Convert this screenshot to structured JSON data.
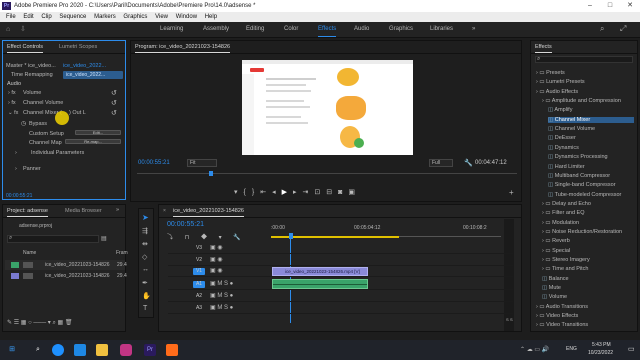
{
  "window": {
    "title": "Adobe Premiere Pro 2020 - C:\\Users\\Paril\\Documents\\Adobe\\Premiere Pro\\14.0\\adsense *",
    "logo": "Pr"
  },
  "menu": [
    "File",
    "Edit",
    "Clip",
    "Sequence",
    "Markers",
    "Graphics",
    "View",
    "Window",
    "Help"
  ],
  "workspaces": {
    "tabs": [
      "Learning",
      "Assembly",
      "Editing",
      "Color",
      "Effects",
      "Audio",
      "Graphics",
      "Libraries"
    ],
    "active": "Effects",
    "more": "»"
  },
  "effect_controls": {
    "tabs": [
      "Effect Controls",
      "Lumetri Scopes"
    ],
    "master": "Master * ice_video...",
    "clip": "ice_video_2022...",
    "time_remapping": "Time Remapping",
    "audio_header": "Audio",
    "effects": [
      "Volume",
      "Channel Volume"
    ],
    "channel_mixer": "Channel Mixer (",
    "channel_mixer_suffix": ") Out L",
    "bypass": "Bypass",
    "custom_setup": "Custom Setup",
    "edit_label": "Edit...",
    "channel_map": "Channel Map",
    "remap_label": "Re-map...",
    "individual_params": "Individual Parameters",
    "panner": "Panner",
    "timecode": "00:00:55:21"
  },
  "program_monitor": {
    "title": "Program: ice_video_20221023-154826",
    "timecode": "00:00:55:21",
    "fit": "Fit",
    "quality": "Full",
    "duration": "00:04:47:12"
  },
  "project": {
    "tabs": [
      "Project: adsense",
      "Media Browser"
    ],
    "file": "adsense.prproj",
    "col_name": "Name",
    "col_fr": "Fram",
    "items": [
      {
        "name": "ice_video_20221023-154826",
        "fr": "29.4"
      },
      {
        "name": "ice_video_20221023-154826",
        "fr": "29.4"
      }
    ]
  },
  "timeline": {
    "tab": "ice_video_20221023-154826",
    "timecode": "00:00:55:21",
    "ruler": [
      ":00:00",
      "00:05:04:12",
      "00:10:08:2"
    ],
    "tracks": [
      "V3",
      "V2",
      "V1",
      "A1",
      "A2",
      "A3"
    ],
    "video_clip": "ice_video_20221023-154826.mp4 [V]",
    "meter_labels": [
      "S",
      "S"
    ]
  },
  "effects_panel": {
    "title": "Effects",
    "tree": [
      {
        "label": "Presets",
        "indent": 0,
        "folder": true
      },
      {
        "label": "Lumetri Presets",
        "indent": 0,
        "folder": true
      },
      {
        "label": "Audio Effects",
        "indent": 0,
        "folder": true
      },
      {
        "label": "Amplitude and Compression",
        "indent": 1,
        "folder": true
      },
      {
        "label": "Amplify",
        "indent": 2
      },
      {
        "label": "Channel Mixer",
        "indent": 2,
        "selected": true
      },
      {
        "label": "Channel Volume",
        "indent": 2
      },
      {
        "label": "DeEsser",
        "indent": 2
      },
      {
        "label": "Dynamics",
        "indent": 2
      },
      {
        "label": "Dynamics Processing",
        "indent": 2
      },
      {
        "label": "Hard Limiter",
        "indent": 2
      },
      {
        "label": "Multiband Compressor",
        "indent": 2
      },
      {
        "label": "Single-band Compressor",
        "indent": 2
      },
      {
        "label": "Tube-modeled Compressor",
        "indent": 2
      },
      {
        "label": "Delay and Echo",
        "indent": 1,
        "folder": true
      },
      {
        "label": "Filter and EQ",
        "indent": 1,
        "folder": true
      },
      {
        "label": "Modulation",
        "indent": 1,
        "folder": true
      },
      {
        "label": "Noise Reduction/Restoration",
        "indent": 1,
        "folder": true
      },
      {
        "label": "Reverb",
        "indent": 1,
        "folder": true
      },
      {
        "label": "Special",
        "indent": 1,
        "folder": true
      },
      {
        "label": "Stereo Imagery",
        "indent": 1,
        "folder": true
      },
      {
        "label": "Time and Pitch",
        "indent": 1,
        "folder": true
      },
      {
        "label": "Balance",
        "indent": 1
      },
      {
        "label": "Mute",
        "indent": 1
      },
      {
        "label": "Volume",
        "indent": 1
      },
      {
        "label": "Audio Transitions",
        "indent": 0,
        "folder": true
      },
      {
        "label": "Video Effects",
        "indent": 0,
        "folder": true
      },
      {
        "label": "Video Transitions",
        "indent": 0,
        "folder": true
      }
    ]
  },
  "taskbar": {
    "lang": "ENG",
    "time": "5:43 PM",
    "date": "10/23/2022"
  },
  "colors": {
    "accent": "#2d8ceb",
    "highlight": "#2c5d8f",
    "clip_video": "#8a8ad8",
    "clip_audio": "#3aa36a",
    "cursor": "#f2d400"
  }
}
